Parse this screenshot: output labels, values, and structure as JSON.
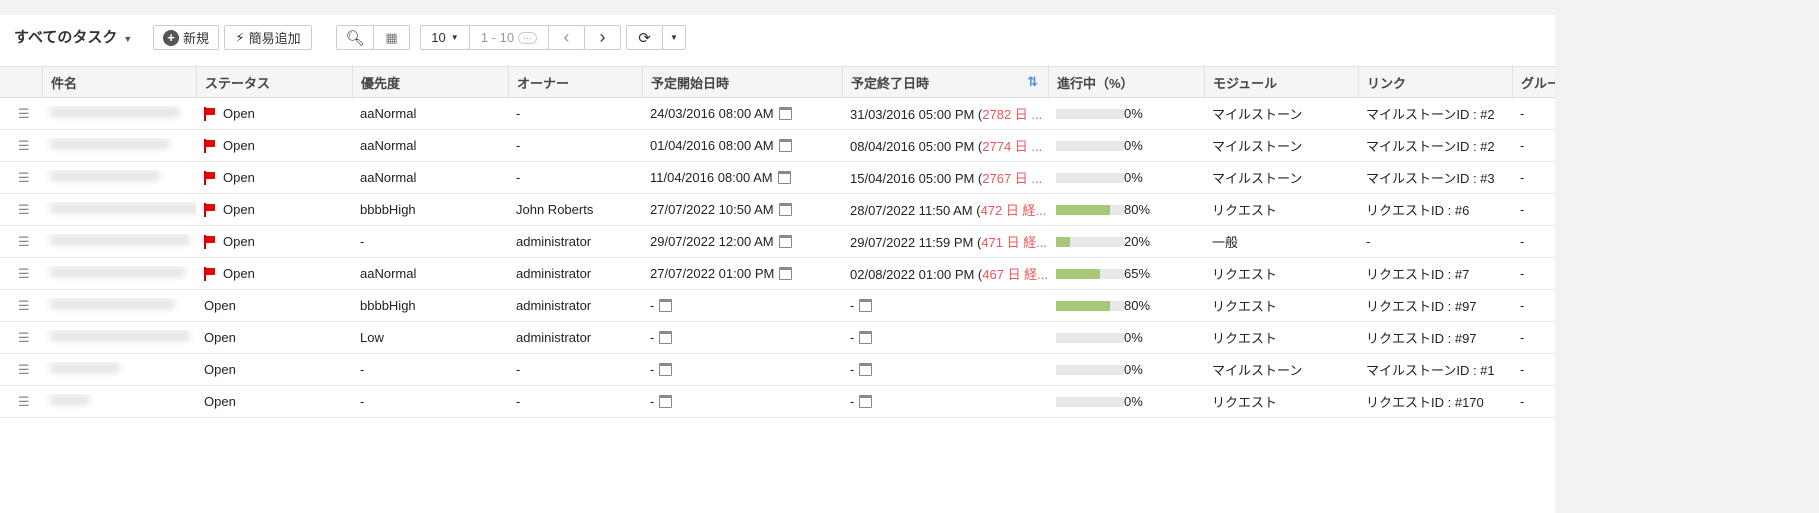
{
  "toolbar": {
    "view_title": "すべてのタスク",
    "new_label": "新規",
    "quick_add_label": "簡易追加",
    "page_size": "10",
    "range": "1 - 10",
    "more": "···"
  },
  "columns": [
    "件名",
    "ステータス",
    "優先度",
    "オーナー",
    "予定開始日時",
    "予定終了日時",
    "進行中（%）",
    "モジュール",
    "リンク",
    "グルー"
  ],
  "rows": [
    {
      "flag": true,
      "status": "Open",
      "priority": "aaNormal",
      "owner": "-",
      "start": "24/03/2016 08:00 AM",
      "end": "31/03/2016 05:00 PM (",
      "overdue": "2782 日 ...",
      "progress": 0,
      "progress_label": "0%",
      "module": "マイルストーン",
      "link": "マイルストーンID : #2",
      "group": "-"
    },
    {
      "flag": true,
      "status": "Open",
      "priority": "aaNormal",
      "owner": "-",
      "start": "01/04/2016 08:00 AM",
      "end": "08/04/2016 05:00 PM (",
      "overdue": "2774 日 ...",
      "progress": 0,
      "progress_label": "0%",
      "module": "マイルストーン",
      "link": "マイルストーンID : #2",
      "group": "-"
    },
    {
      "flag": true,
      "status": "Open",
      "priority": "aaNormal",
      "owner": "-",
      "start": "11/04/2016 08:00 AM",
      "end": "15/04/2016 05:00 PM (",
      "overdue": "2767 日 ...",
      "progress": 0,
      "progress_label": "0%",
      "module": "マイルストーン",
      "link": "マイルストーンID : #3",
      "group": "-"
    },
    {
      "flag": true,
      "status": "Open",
      "priority": "bbbbHigh",
      "owner": "John Roberts",
      "start": "27/07/2022 10:50 AM",
      "end": "28/07/2022 11:50 AM (",
      "overdue": "472 日 経...",
      "progress": 80,
      "progress_label": "80%",
      "module": "リクエスト",
      "link": "リクエストID : #6",
      "group": "-"
    },
    {
      "flag": true,
      "status": "Open",
      "priority": "-",
      "owner": "administrator",
      "start": "29/07/2022 12:00 AM",
      "end": "29/07/2022 11:59 PM (",
      "overdue": "471 日 経...",
      "progress": 20,
      "progress_label": "20%",
      "module": "一般",
      "link": "-",
      "group": "-"
    },
    {
      "flag": true,
      "status": "Open",
      "priority": "aaNormal",
      "owner": "administrator",
      "start": "27/07/2022 01:00 PM",
      "end": "02/08/2022 01:00 PM (",
      "overdue": "467 日 経...",
      "progress": 65,
      "progress_label": "65%",
      "module": "リクエスト",
      "link": "リクエストID : #7",
      "group": "-"
    },
    {
      "flag": false,
      "status": "Open",
      "priority": "bbbbHigh",
      "owner": "administrator",
      "start": "-",
      "end": "-",
      "overdue": "",
      "progress": 80,
      "progress_label": "80%",
      "module": "リクエスト",
      "link": "リクエストID : #97",
      "group": "-"
    },
    {
      "flag": false,
      "status": "Open",
      "priority": "Low",
      "owner": "administrator",
      "start": "-",
      "end": "-",
      "overdue": "",
      "progress": 0,
      "progress_label": "0%",
      "module": "リクエスト",
      "link": "リクエストID : #97",
      "group": "-"
    },
    {
      "flag": false,
      "status": "Open",
      "priority": "-",
      "owner": "-",
      "start": "-",
      "end": "-",
      "overdue": "",
      "progress": 0,
      "progress_label": "0%",
      "module": "マイルストーン",
      "link": "マイルストーンID : #1",
      "group": "-"
    },
    {
      "flag": false,
      "status": "Open",
      "priority": "-",
      "owner": "-",
      "start": "-",
      "end": "-",
      "overdue": "",
      "progress": 0,
      "progress_label": "0%",
      "module": "リクエスト",
      "link": "リクエストID : #170",
      "group": "-"
    }
  ]
}
